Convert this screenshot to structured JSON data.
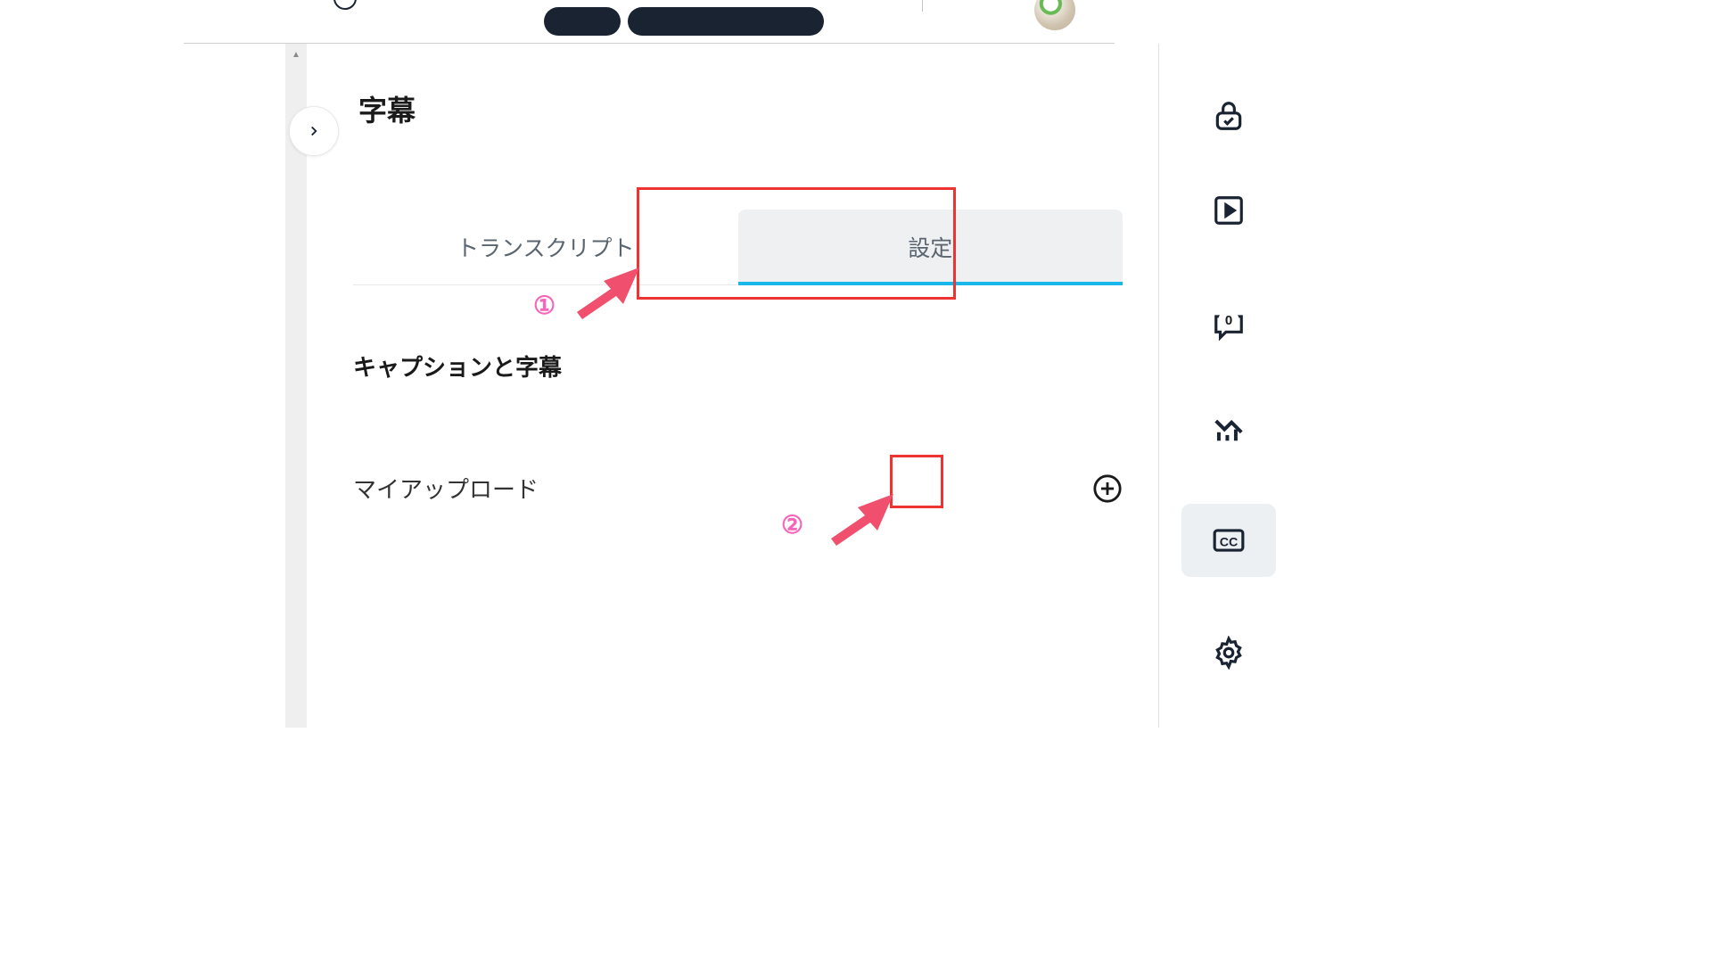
{
  "page": {
    "title": "字幕"
  },
  "tabs": {
    "transcript": "トランスクリプト",
    "settings": "設定"
  },
  "sections": {
    "captions": "キャプションと字幕",
    "uploads": "マイアップロード"
  },
  "sidebar": {
    "comment_count": "0"
  },
  "annotations": {
    "step1": "①",
    "step2": "②"
  },
  "colors": {
    "highlight": "#ee3333",
    "accent": "#1ab7ea",
    "annotation": "#f565b9"
  }
}
